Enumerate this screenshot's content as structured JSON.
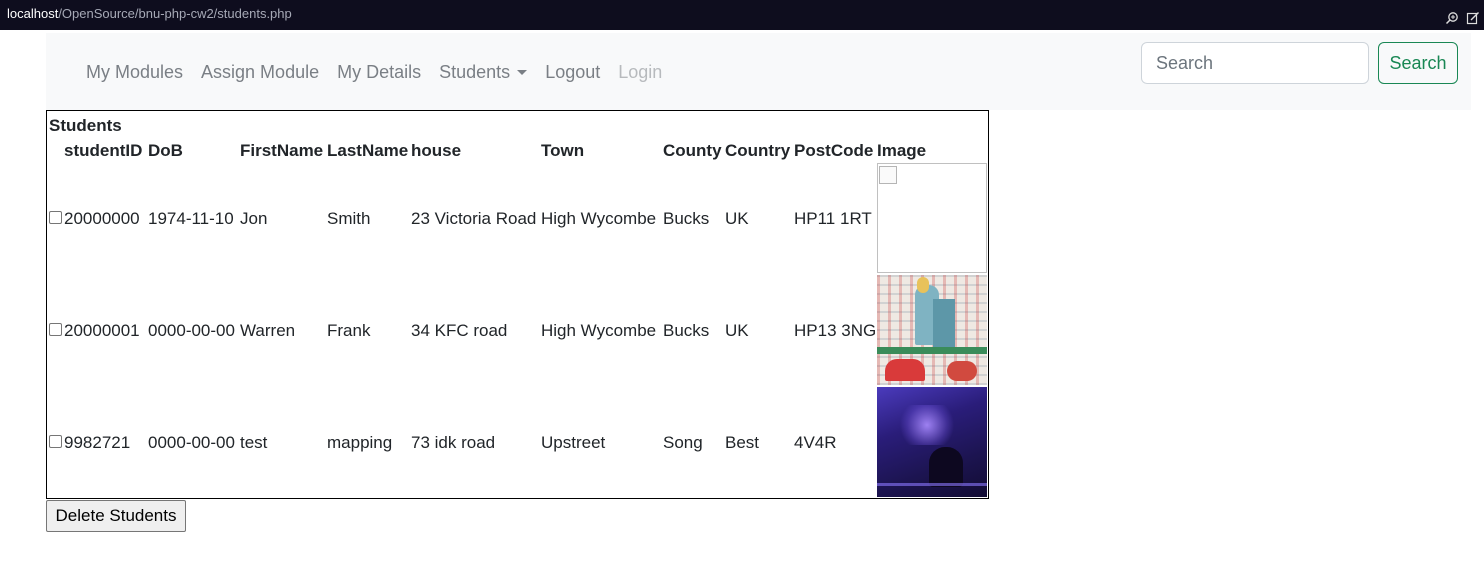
{
  "browser": {
    "host": "localhost",
    "path": "/OpenSource/bnu-php-cw2/students.php",
    "icons": [
      "zoom-icon",
      "edit-icon"
    ]
  },
  "nav": {
    "links": [
      "My Modules",
      "Assign Module",
      "My Details",
      "Students",
      "Logout",
      "Login"
    ],
    "search_placeholder": "Search",
    "search_button": "Search",
    "accent": "#198754"
  },
  "table": {
    "caption": "Students",
    "headers": [
      "studentID",
      "DoB",
      "FirstName",
      "LastName",
      "house",
      "Town",
      "County",
      "Country",
      "PostCode",
      "Image"
    ],
    "rows": [
      {
        "studentID": "20000000",
        "DoB": "1974-11-10",
        "FirstName": "Jon",
        "LastName": "Smith",
        "house": "23 Victoria Road",
        "Town": "High Wycombe",
        "County": "Bucks",
        "Country": "UK",
        "PostCode": "HP11 1RT",
        "image": "broken-image"
      },
      {
        "studentID": "20000001",
        "DoB": "0000-00-00",
        "FirstName": "Warren",
        "LastName": "Frank",
        "house": "34 KFC road",
        "Town": "High Wycombe",
        "County": "Bucks",
        "Country": "UK",
        "PostCode": "HP13 3NG",
        "image": "illustration-thumbnail"
      },
      {
        "studentID": "9982721",
        "DoB": "0000-00-00",
        "FirstName": "test",
        "LastName": "mapping",
        "house": "73 idk road",
        "Town": "Upstreet",
        "County": "Song",
        "Country": "Best",
        "PostCode": "4V4R",
        "image": "night-scene-thumbnail"
      }
    ]
  },
  "delete_button": "Delete Students"
}
